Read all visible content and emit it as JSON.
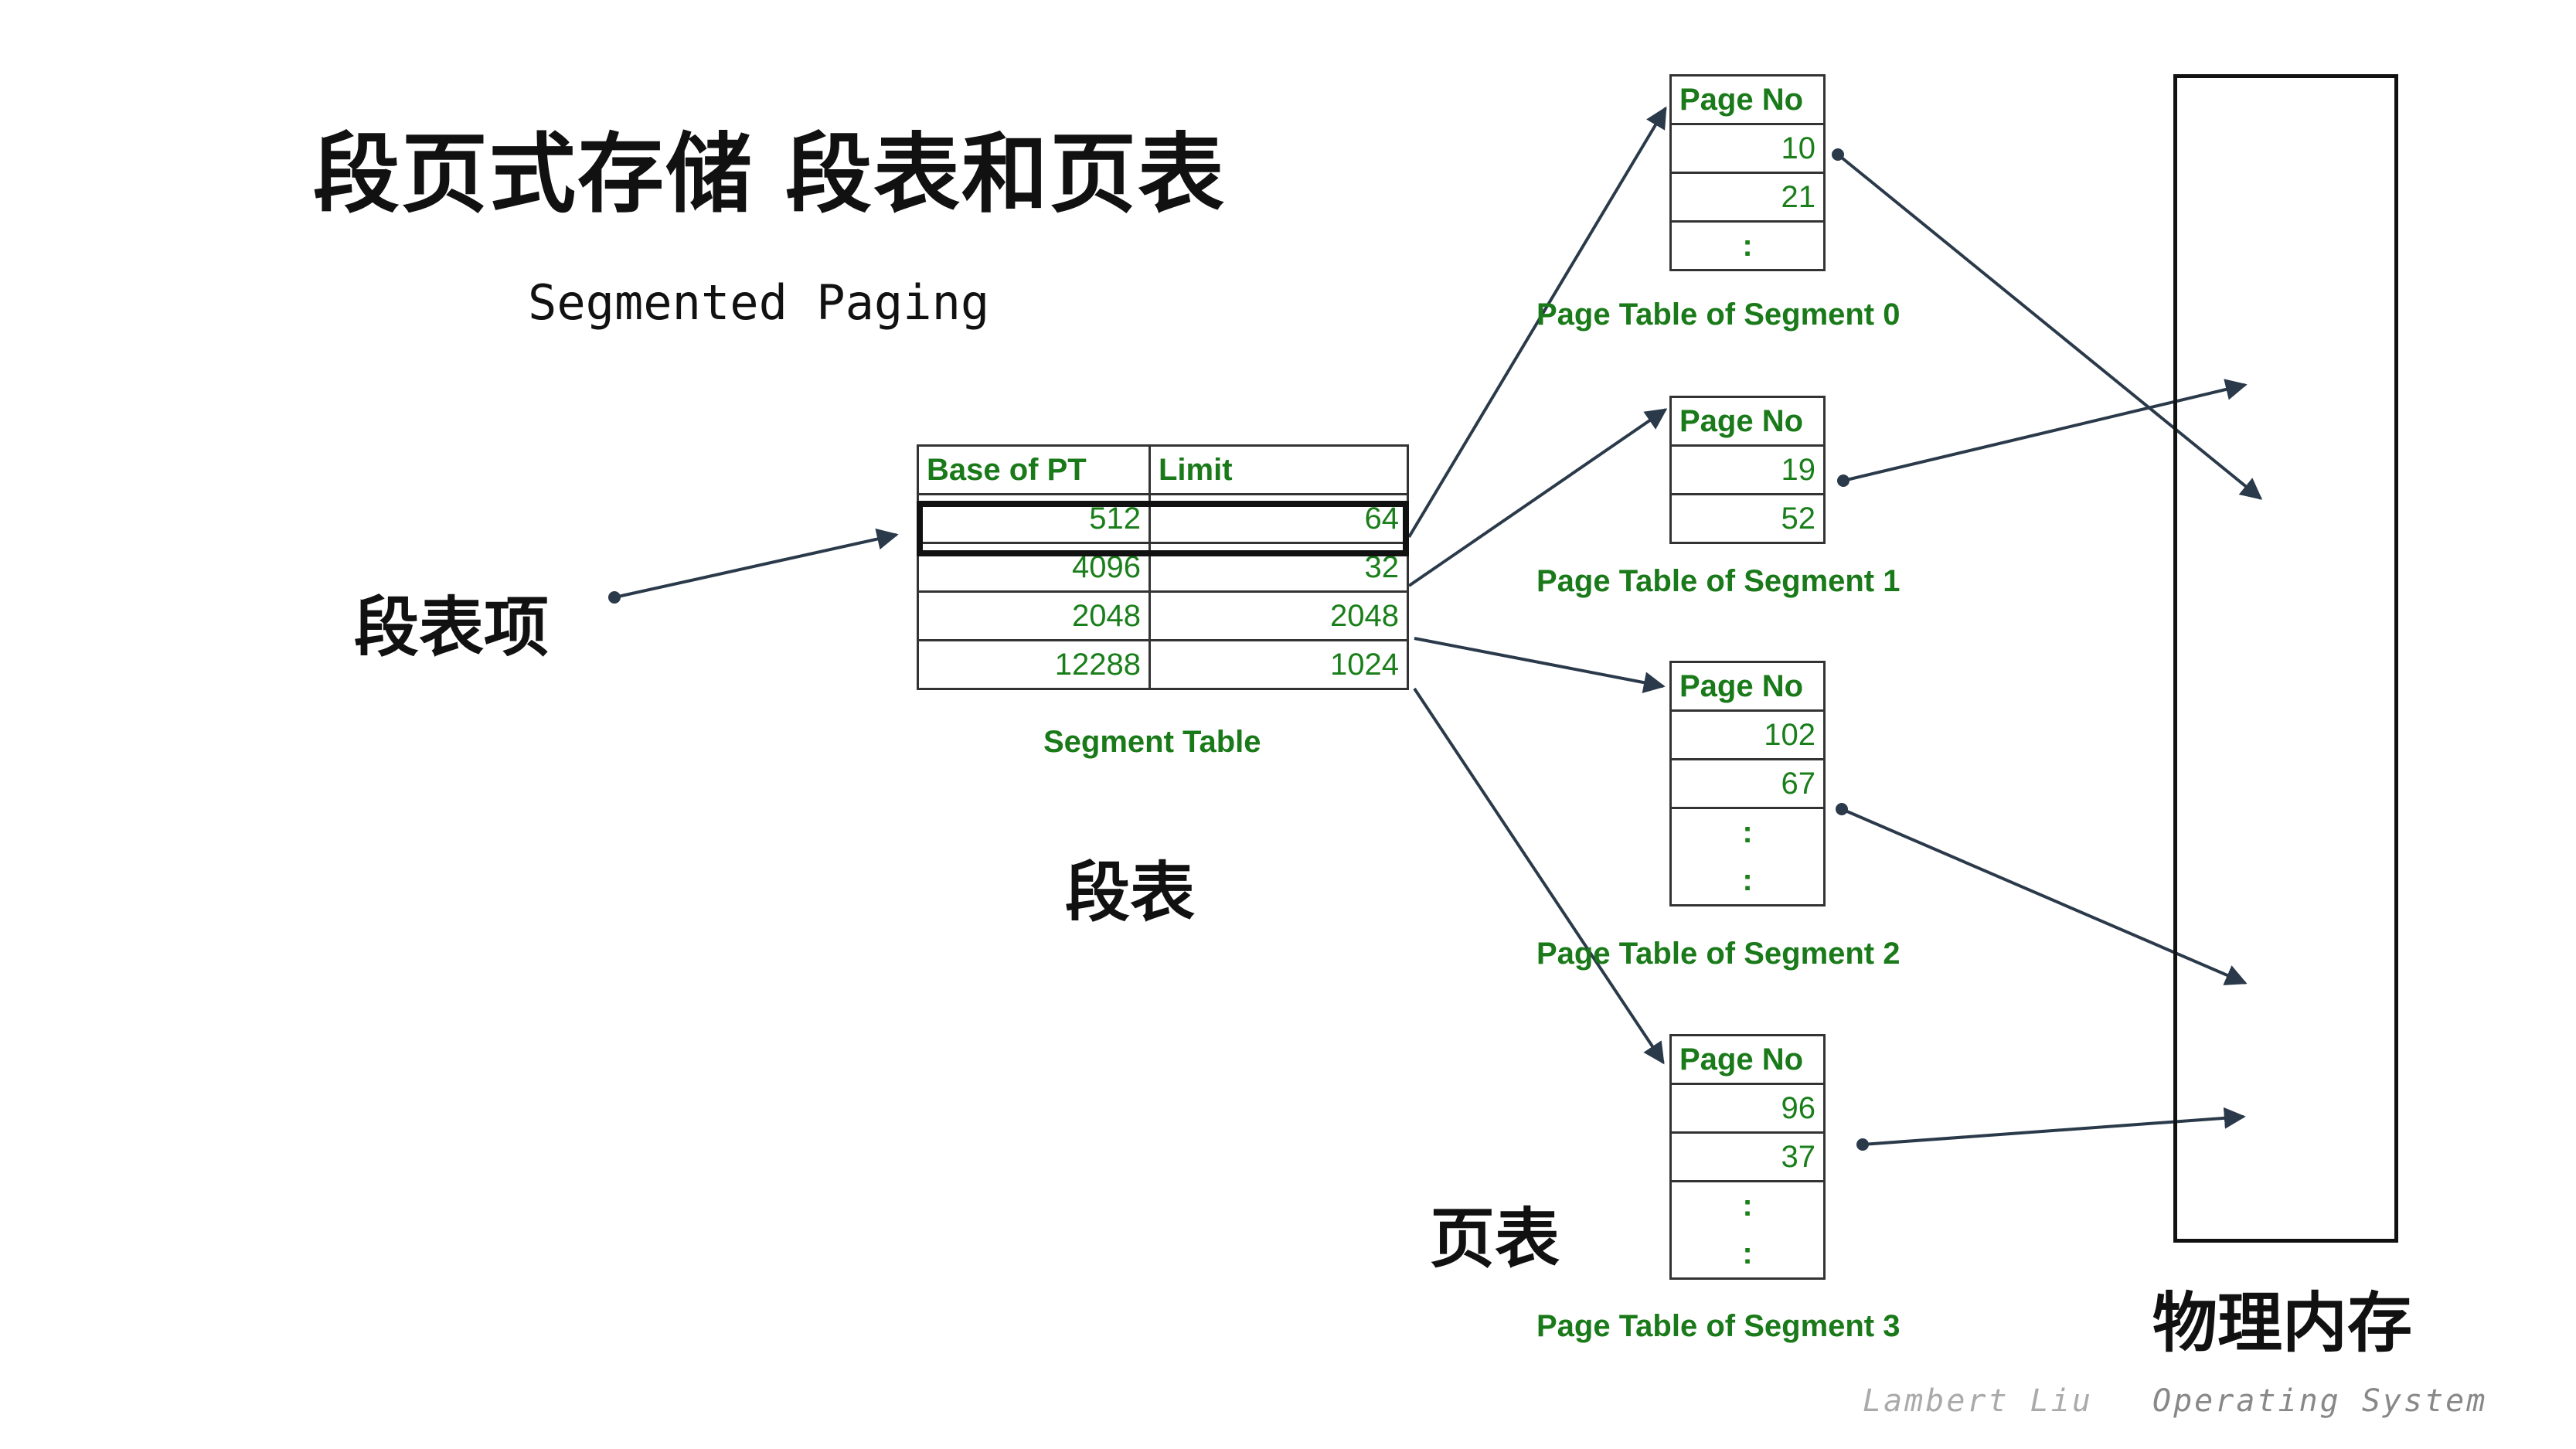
{
  "title": "段页式存储  段表和页表",
  "subtitle": "Segmented Paging",
  "labels": {
    "segment_entry": "段表项",
    "segment_table": "段表",
    "page_table": "页表",
    "physical_memory": "物理内存"
  },
  "segment_table": {
    "headers": [
      "Base of PT",
      "Limit"
    ],
    "rows": [
      [
        "512",
        "64"
      ],
      [
        "4096",
        "32"
      ],
      [
        "2048",
        "2048"
      ],
      [
        "12288",
        "1024"
      ]
    ],
    "caption": "Segment Table"
  },
  "page_tables": [
    {
      "header": "Page No",
      "entries": [
        "10",
        "21",
        ":"
      ],
      "caption": "Page Table of Segment 0"
    },
    {
      "header": "Page No",
      "entries": [
        "19",
        "52"
      ],
      "caption": "Page Table of Segment 1"
    },
    {
      "header": "Page No",
      "entries": [
        "102",
        "67",
        ":",
        ":"
      ],
      "caption": "Page Table of Segment 2"
    },
    {
      "header": "Page No",
      "entries": [
        "96",
        "37",
        ":",
        ":"
      ],
      "caption": "Page Table of Segment 3"
    }
  ],
  "footer": {
    "author": "Lambert Liu",
    "course": "Operating System"
  },
  "colors": {
    "table_text": "#1a7f1a",
    "arrow": "#2b3a4a",
    "text": "#111111"
  }
}
